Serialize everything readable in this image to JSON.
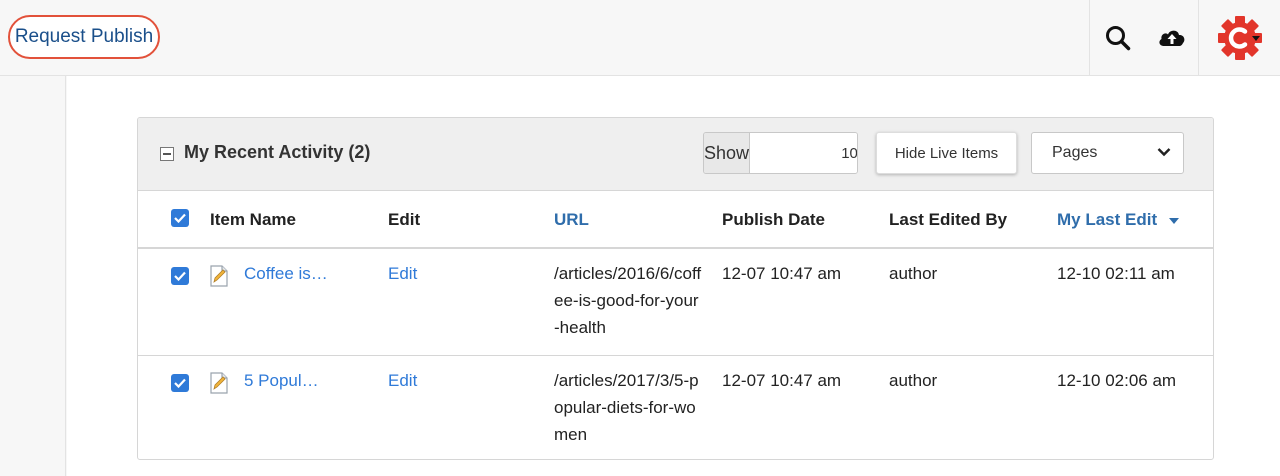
{
  "toolbar": {
    "request_publish": "Request Publish",
    "icons": [
      "search-icon",
      "cloud-upload-icon",
      "brand-logo-menu"
    ]
  },
  "widget": {
    "title": "My Recent Activity (2)",
    "show_label": "Show",
    "show_value": "10",
    "hide_button": "Hide Live Items",
    "filter_selected": "Pages"
  },
  "table": {
    "headers": {
      "item_name": "Item Name",
      "edit": "Edit",
      "url": "URL",
      "publish_date": "Publish Date",
      "last_edited_by": "Last Edited By",
      "my_last_edit": "My Last Edit"
    },
    "rows": [
      {
        "checked": true,
        "name": "Coffee is…",
        "edit": "Edit",
        "url": "/articles/2016/6/coffee-is-good-for-your-health",
        "publish_date": "12-07 10:47 am",
        "last_edited_by": "author",
        "my_last_edit": "12-10 02:11 am"
      },
      {
        "checked": true,
        "name": "5 Popul…",
        "edit": "Edit",
        "url": "/articles/2017/3/5-popular-diets-for-women",
        "publish_date": "12-07 10:47 am",
        "last_edited_by": "author",
        "my_last_edit": "12-10 02:06 am"
      }
    ]
  },
  "colors": {
    "accent_blue": "#2f7ad8",
    "header_blue": "#2f6dab",
    "request_border": "#e2513a",
    "brand_red": "#e2352a"
  }
}
